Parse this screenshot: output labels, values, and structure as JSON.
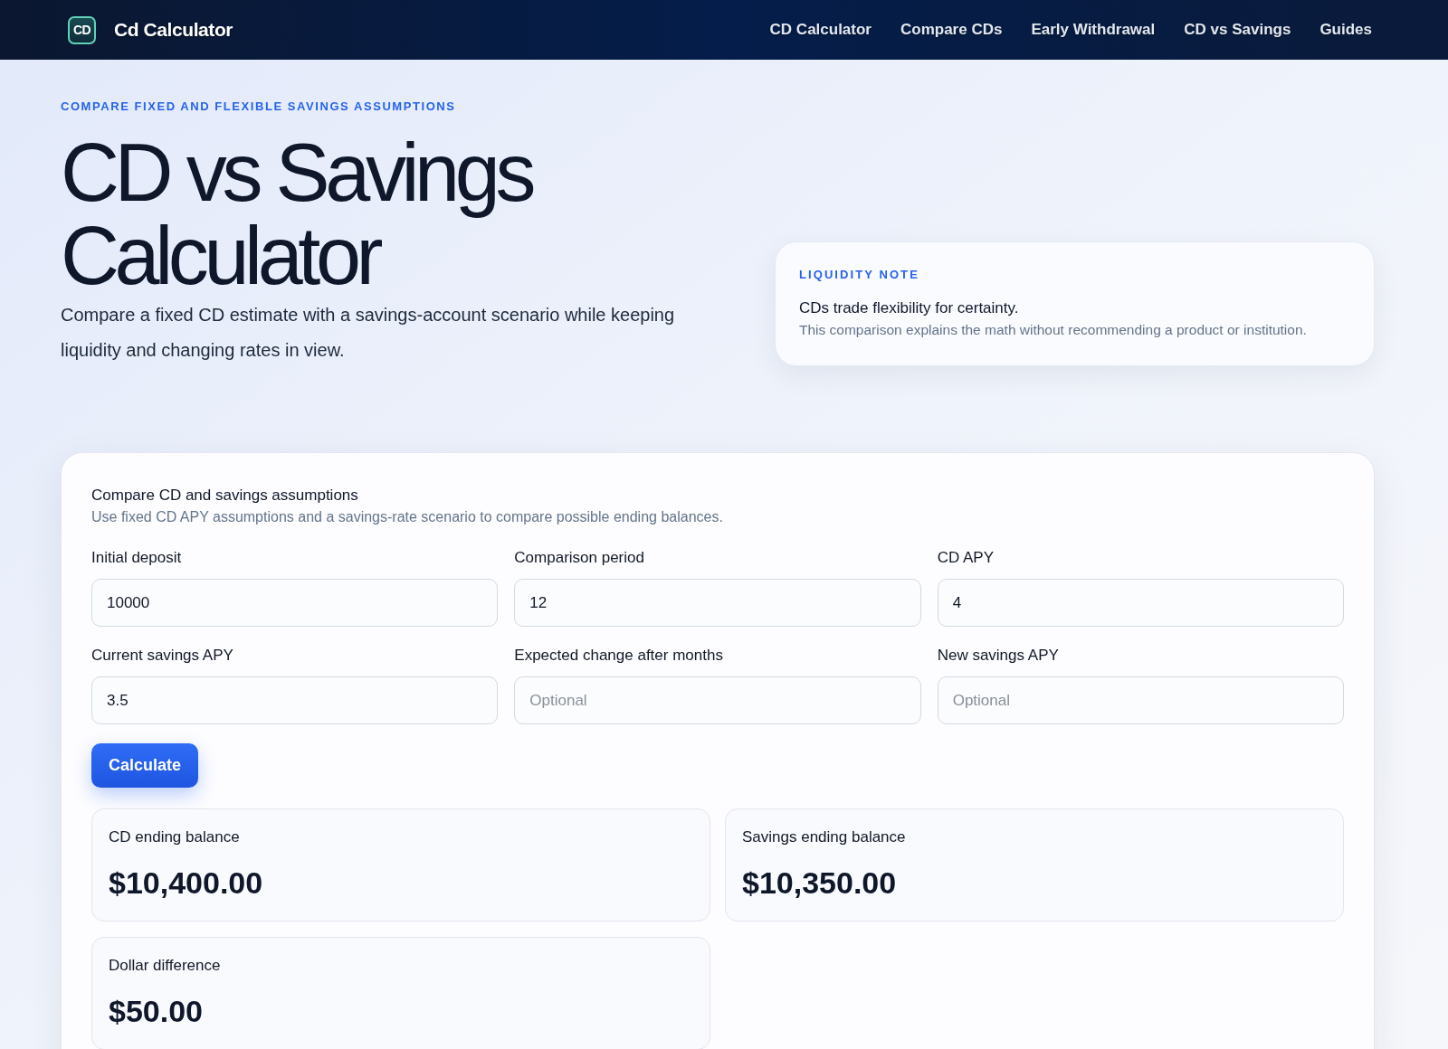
{
  "header": {
    "logo_mark": "CD",
    "brand": "Cd Calculator",
    "nav": [
      "CD Calculator",
      "Compare CDs",
      "Early Withdrawal",
      "CD vs Savings",
      "Guides"
    ]
  },
  "hero": {
    "eyebrow": "COMPARE FIXED AND FLEXIBLE SAVINGS ASSUMPTIONS",
    "title": "CD vs Savings Calculator",
    "description": "Compare a fixed CD estimate with a savings-account scenario while keeping liquidity and changing rates in view."
  },
  "note_card": {
    "eyebrow": "LIQUIDITY NOTE",
    "headline": "CDs trade flexibility for certainty.",
    "body": "This comparison explains the math without recommending a product or institution."
  },
  "calculator": {
    "title": "Compare CD and savings assumptions",
    "subtitle": "Use fixed CD APY assumptions and a savings-rate scenario to compare possible ending balances.",
    "fields": [
      {
        "label": "Initial deposit",
        "value": "10000"
      },
      {
        "label": "Comparison period",
        "value": "12"
      },
      {
        "label": "CD APY",
        "value": "4"
      },
      {
        "label": "Current savings APY",
        "value": "3.5"
      },
      {
        "label": "Expected change after months",
        "placeholder": "Optional"
      },
      {
        "label": "New savings APY",
        "placeholder": "Optional"
      }
    ],
    "button": "Calculate",
    "results": [
      {
        "label": "CD ending balance",
        "value": "$10,400.00"
      },
      {
        "label": "Savings ending balance",
        "value": "$10,350.00"
      },
      {
        "label": "Dollar difference",
        "value": "$50.00"
      }
    ]
  }
}
